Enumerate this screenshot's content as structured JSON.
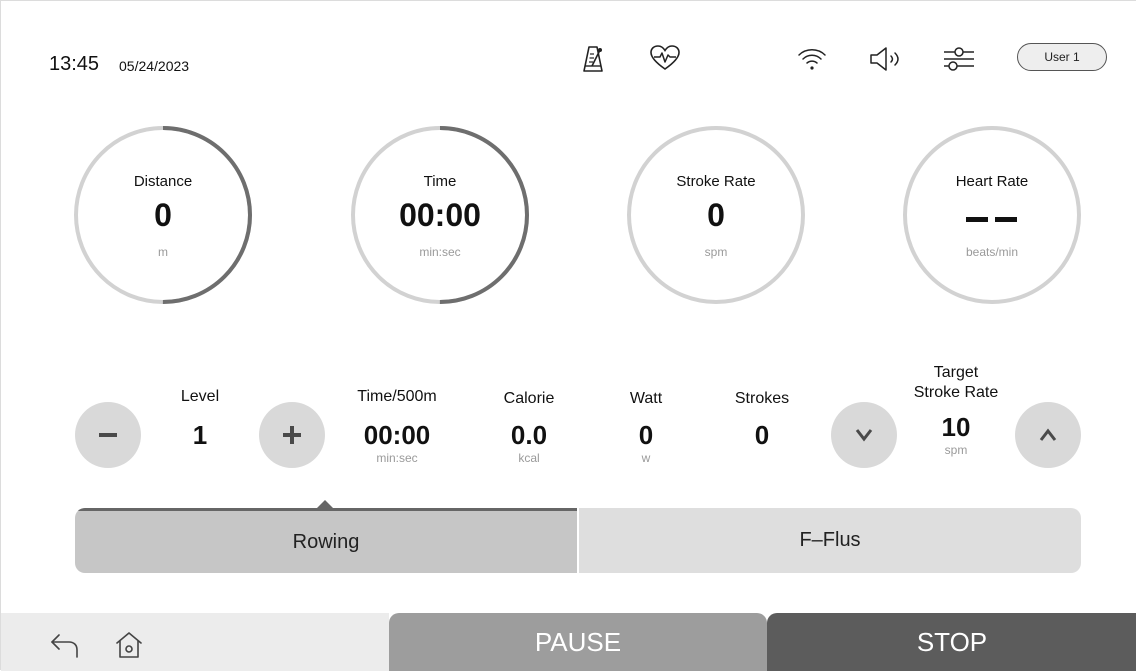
{
  "header": {
    "time": "13:45",
    "date": "05/24/2023",
    "user_label": "User 1",
    "icons": [
      "metronome-icon",
      "heart-rate-icon",
      "wifi-icon",
      "volume-icon",
      "settings-sliders-icon"
    ]
  },
  "gauges": [
    {
      "label": "Distance",
      "value": "0",
      "unit": "m",
      "progress": 0.5
    },
    {
      "label": "Time",
      "value": "00:00",
      "unit": "min:sec",
      "progress": 0.5
    },
    {
      "label": "Stroke Rate",
      "value": "0",
      "unit": "spm",
      "progress": 0
    },
    {
      "label": "Heart Rate",
      "value": "",
      "unit": "beats/min",
      "progress": 0
    }
  ],
  "stats": {
    "level": {
      "label": "Level",
      "value": "1"
    },
    "time500": {
      "label": "Time/500m",
      "value": "00:00",
      "unit": "min:sec"
    },
    "calorie": {
      "label": "Calorie",
      "value": "0.0",
      "unit": "kcal"
    },
    "watt": {
      "label": "Watt",
      "value": "0",
      "unit": "w"
    },
    "strokes": {
      "label": "Strokes",
      "value": "0"
    },
    "target": {
      "label_line1": "Target",
      "label_line2": "Stroke Rate",
      "value": "10",
      "unit": "spm"
    }
  },
  "modes": {
    "rowing": "Rowing",
    "fplus": "F–Flus",
    "selected": "rowing"
  },
  "footer": {
    "pause": "PAUSE",
    "stop": "STOP"
  },
  "colors": {
    "ring_track": "#d2d2d2",
    "ring_progress": "#6e6e6e",
    "stop": "#5c5c5c",
    "pause": "#9d9d9d"
  }
}
